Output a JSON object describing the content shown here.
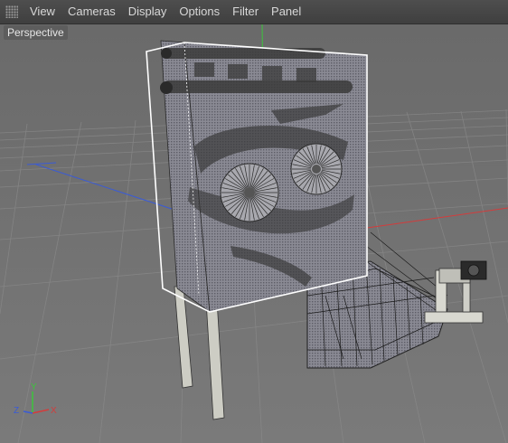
{
  "menubar": {
    "items": [
      "View",
      "Cameras",
      "Display",
      "Options",
      "Filter",
      "Panel"
    ]
  },
  "viewport": {
    "label": "Perspective"
  },
  "axis_gizmo": {
    "x": "X",
    "y": "Y",
    "z": "Z"
  },
  "colors": {
    "background": "#6f6f6f",
    "menubar": "#444444",
    "axis_x": "#d33c3c",
    "axis_y": "#3cc43c",
    "axis_z": "#3a5bd6",
    "selection": "#ffffff"
  }
}
